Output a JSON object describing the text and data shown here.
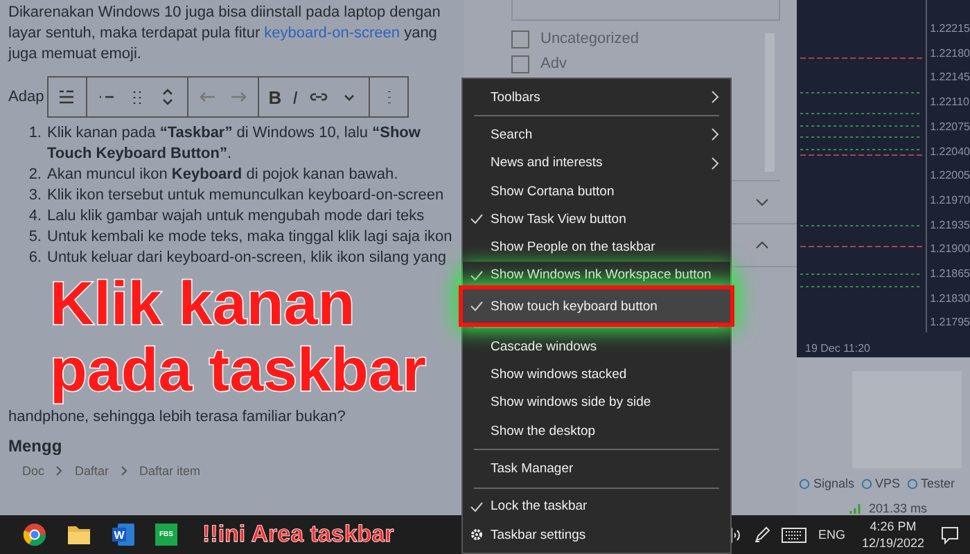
{
  "article": {
    "intro_before": "Dikarenakan Windows 10 juga bisa diinstall pada laptop dengan layar sentuh, maka terdapat pula fitur",
    "intro_link": "keyboard-on-screen",
    "intro_after": "yang juga memuat emoji.",
    "lead": "Adap",
    "toolbar": [
      {
        "kind": "icon"
      },
      {
        "kind": "icon"
      },
      {
        "kind": "icon"
      },
      {
        "kind": "icon"
      },
      {
        "kind": "icon"
      },
      {
        "kind": "icon"
      },
      {
        "kind": "text",
        "label": "B"
      },
      {
        "kind": "text",
        "label": "I"
      },
      {
        "kind": "icon"
      },
      {
        "kind": "icon"
      },
      {
        "kind": "icon"
      }
    ],
    "steps": [
      {
        "number": "1.",
        "text": "Klik kanan pada **“Taskbar”** di Windows 10, lalu **“Show Touch Keyboard Button”**."
      },
      {
        "number": "2.",
        "text": "Akan muncul ikon **Keyboard** di pojok kanan bawah."
      },
      {
        "number": "3.",
        "text": "Klik ikon tersebut untuk memunculkan keyboard-on-screen"
      },
      {
        "number": "4.",
        "text": "Lalu klik gambar wajah untuk mengubah mode dari teks"
      },
      {
        "number": "5.",
        "text": "Untuk kembali ke mode teks, maka tinggal klik lagi saja ikon"
      },
      {
        "number": "6.",
        "text": "Untuk keluar dari keyboard-on-screen, klik ikon silang yang"
      }
    ],
    "closing": "handphone, sehingga lebih terasa familiar bukan?",
    "heading": "Mengg",
    "breadcrumb": [
      "Doc",
      "Daftar",
      "Daftar item"
    ]
  },
  "caption": [
    "Klik kanan",
    "pada taskbar"
  ],
  "categories": [
    {
      "label": "Uncategorized",
      "checked": false
    },
    {
      "label": "Adv",
      "checked": false
    }
  ],
  "chart": {
    "price_axis": [
      "1.22215",
      "1.22180",
      "1.22145",
      "1.22110",
      "1.22075",
      "1.22040",
      "1.22005",
      "1.21970",
      "1.21935",
      "1.21900",
      "1.21865",
      "1.21830",
      "1.21795"
    ],
    "time_label": "19 Dec 11:20",
    "tabs": [
      "Signals",
      "VPS",
      "Tester"
    ],
    "ping": "201.33 ms"
  },
  "menu": [
    {
      "kind": "item",
      "label": "Toolbars",
      "submenu": true,
      "checked": false,
      "selected": false
    },
    {
      "kind": "separator"
    },
    {
      "kind": "item",
      "label": "Search",
      "submenu": true,
      "checked": false,
      "selected": false
    },
    {
      "kind": "item",
      "label": "News and interests",
      "submenu": true,
      "checked": false,
      "selected": false
    },
    {
      "kind": "item",
      "label": "Show Cortana button",
      "submenu": false,
      "checked": false,
      "selected": false
    },
    {
      "kind": "item",
      "label": "Show Task View button",
      "submenu": false,
      "checked": true,
      "selected": false
    },
    {
      "kind": "item",
      "label": "Show People on the taskbar",
      "submenu": false,
      "checked": false,
      "selected": false
    },
    {
      "kind": "item",
      "label": "Show Windows Ink Workspace button",
      "submenu": false,
      "checked": true,
      "selected": false
    },
    {
      "kind": "item",
      "label": "Show touch keyboard button",
      "submenu": false,
      "checked": true,
      "selected": true
    },
    {
      "kind": "separator"
    },
    {
      "kind": "item",
      "label": "Cascade windows",
      "submenu": false,
      "checked": false,
      "selected": false
    },
    {
      "kind": "item",
      "label": "Show windows stacked",
      "submenu": false,
      "checked": false,
      "selected": false
    },
    {
      "kind": "item",
      "label": "Show windows side by side",
      "submenu": false,
      "checked": false,
      "selected": false
    },
    {
      "kind": "item",
      "label": "Show the desktop",
      "submenu": false,
      "checked": false,
      "selected": false
    },
    {
      "kind": "separator"
    },
    {
      "kind": "item",
      "label": "Task Manager",
      "submenu": false,
      "checked": false,
      "selected": false
    },
    {
      "kind": "separator"
    },
    {
      "kind": "item",
      "label": "Lock the taskbar",
      "submenu": false,
      "checked": true,
      "selected": false
    },
    {
      "kind": "settings",
      "label": "Taskbar settings",
      "selected": false
    }
  ],
  "taskbar": {
    "apps": [
      {
        "kind": "browser"
      },
      {
        "kind": "folder"
      },
      {
        "kind": "word",
        "label": "W"
      },
      {
        "kind": "fbs",
        "label": "FBS"
      }
    ],
    "note": "!!ini Area taskbar",
    "language": "ENG",
    "time": "4:26 PM",
    "date": "12/19/2022"
  }
}
